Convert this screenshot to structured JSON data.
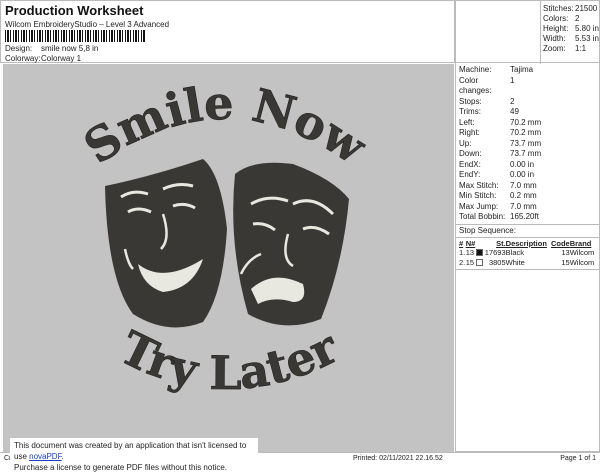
{
  "header": {
    "title": "Production Worksheet",
    "software": "Wilcom EmbroideryStudio – Level 3 Advanced",
    "design_label": "Design:",
    "design_value": "smile now 5,8 in",
    "colorway_label": "Colorway:",
    "colorway_value": "Colorway 1"
  },
  "stats": [
    {
      "k": "Stitches:",
      "v": "21500"
    },
    {
      "k": "Colors:",
      "v": "2"
    },
    {
      "k": "Height:",
      "v": "5.80 in"
    },
    {
      "k": "Width:",
      "v": "5.53 in"
    },
    {
      "k": "Zoom:",
      "v": "1:1"
    }
  ],
  "info": [
    {
      "k": "Machine:",
      "v": "Tajima"
    },
    {
      "k": "Color changes:",
      "v": "1"
    },
    {
      "k": "Stops:",
      "v": "2"
    },
    {
      "k": "Trims:",
      "v": "49"
    },
    {
      "k": "Left:",
      "v": "70.2 mm"
    },
    {
      "k": "Right:",
      "v": "70.2 mm"
    },
    {
      "k": "Up:",
      "v": "73.7 mm"
    },
    {
      "k": "Down:",
      "v": "73.7 mm"
    },
    {
      "k": "EndX:",
      "v": "0.00 in"
    },
    {
      "k": "EndY:",
      "v": "0.00 in"
    },
    {
      "k": "Max Stitch:",
      "v": "7.0 mm"
    },
    {
      "k": "Min Stitch:",
      "v": "0.2 mm"
    },
    {
      "k": "Max Jump:",
      "v": "7.0 mm"
    },
    {
      "k": "Total Bobbin:",
      "v": "165.20ft"
    }
  ],
  "stop_sequence": {
    "title": "Stop Sequence:",
    "headers": [
      "#",
      "N#",
      "St.",
      "Description",
      "Code",
      "Brand"
    ],
    "rows": [
      {
        "n": "1.",
        "num": "13",
        "color": "#111111",
        "st": "17693",
        "desc": "Black",
        "code": "13",
        "brand": "Wilcom"
      },
      {
        "n": "2.",
        "num": "15",
        "color": "#ffffff",
        "st": "3805",
        "desc": "White",
        "code": "15",
        "brand": "Wilcom"
      }
    ]
  },
  "design_artwork": {
    "top_text": "Smile Now",
    "bottom_text": "Try Later",
    "thread_dark": "#3a3835",
    "thread_light": "#e8e8e0"
  },
  "footer": {
    "left": "Cr",
    "printed": "Printed: 02/11/2021 22.16.52",
    "page": "Page 1 of 1"
  },
  "notice": {
    "line1": "This document was created by an application that isn't licensed to use ",
    "link": "novaPDF",
    "line1_end": ".",
    "line2": "Purchase a license to generate PDF files without this notice."
  }
}
